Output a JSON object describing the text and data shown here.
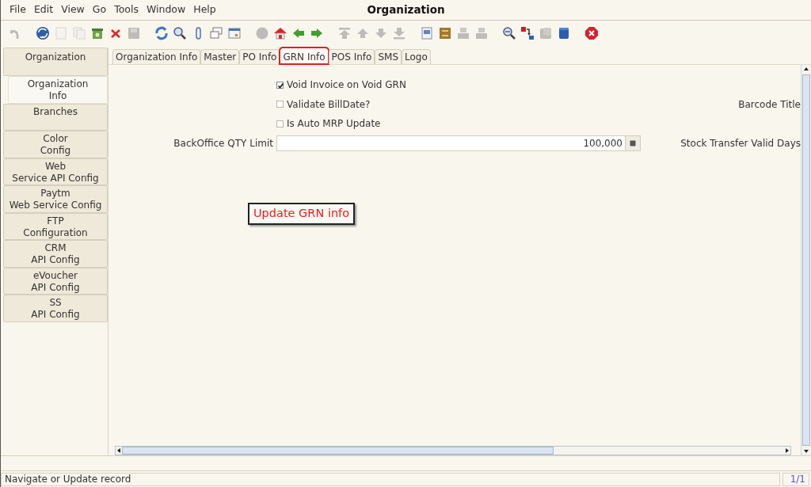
{
  "window": {
    "title": "Organization"
  },
  "menu": [
    "File",
    "Edit",
    "View",
    "Go",
    "Tools",
    "Window",
    "Help"
  ],
  "toolbar": [
    [
      {
        "kind": "undo",
        "disabled": true
      }
    ],
    [
      {
        "kind": "help",
        "disabled": false
      },
      {
        "kind": "new",
        "disabled": true
      },
      {
        "kind": "copy",
        "disabled": true
      },
      {
        "kind": "bin",
        "disabled": false
      },
      {
        "kind": "delete",
        "disabled": false
      },
      {
        "kind": "save",
        "disabled": true
      }
    ],
    [
      {
        "kind": "refresh",
        "disabled": false
      },
      {
        "kind": "find",
        "disabled": false
      },
      {
        "kind": "attach",
        "disabled": false
      },
      {
        "kind": "chat",
        "disabled": false
      },
      {
        "kind": "calendar",
        "disabled": false
      }
    ],
    [
      {
        "kind": "archive",
        "disabled": true
      },
      {
        "kind": "home",
        "disabled": false
      },
      {
        "kind": "back",
        "disabled": false
      },
      {
        "kind": "forward",
        "disabled": false
      }
    ],
    [
      {
        "kind": "first",
        "disabled": true
      },
      {
        "kind": "previous",
        "disabled": true
      },
      {
        "kind": "next",
        "disabled": true
      },
      {
        "kind": "last",
        "disabled": true
      }
    ],
    [
      {
        "kind": "report",
        "disabled": false
      },
      {
        "kind": "drawer",
        "disabled": false
      },
      {
        "kind": "print",
        "disabled": true
      },
      {
        "kind": "print",
        "disabled": true
      }
    ],
    [
      {
        "kind": "zoom",
        "disabled": false
      },
      {
        "kind": "workflow",
        "disabled": false
      },
      {
        "kind": "product",
        "disabled": true
      },
      {
        "kind": "cube",
        "disabled": false
      }
    ],
    [
      {
        "kind": "exit",
        "disabled": false
      }
    ]
  ],
  "sidebar": {
    "items": [
      {
        "label": "Organization",
        "selected": false
      },
      {
        "label": "Organization\nInfo",
        "selected": true
      },
      {
        "label": "Branches",
        "selected": false
      },
      {
        "label": "Color\nConfig",
        "selected": false
      },
      {
        "label": "Web\nService API Config",
        "selected": false
      },
      {
        "label": "Paytm\nWeb Service Config",
        "selected": false
      },
      {
        "label": "FTP\nConfiguration",
        "selected": false
      },
      {
        "label": "CRM\nAPI Config",
        "selected": false
      },
      {
        "label": "eVoucher\nAPI Config",
        "selected": false
      },
      {
        "label": "SS\nAPI Config",
        "selected": false
      }
    ]
  },
  "tabs": [
    {
      "label": "Organization Info",
      "selected": false,
      "highlighted": false
    },
    {
      "label": "Master",
      "selected": false,
      "highlighted": false
    },
    {
      "label": "PO Info",
      "selected": false,
      "highlighted": false
    },
    {
      "label": "GRN Info",
      "selected": true,
      "highlighted": true
    },
    {
      "label": "POS Info",
      "selected": false,
      "highlighted": false
    },
    {
      "label": "SMS",
      "selected": false,
      "highlighted": false
    },
    {
      "label": "Logo",
      "selected": false,
      "highlighted": false
    }
  ],
  "form": {
    "rows": [
      {
        "kind": "checkbox",
        "label": "Void Invoice on Void GRN",
        "checked": true
      },
      {
        "kind": "checkbox",
        "label": "Validate BillDate?",
        "checked": false,
        "side_label": "Barcode Title"
      },
      {
        "kind": "checkbox",
        "label": "Is Auto MRP Update",
        "checked": false
      },
      {
        "kind": "number",
        "label": "BackOffice QTY Limit",
        "value": "100,000",
        "side_label": "Stock Transfer Valid Days"
      }
    ]
  },
  "annotation": {
    "text": "Update GRN info"
  },
  "status_bar": {
    "message": "Navigate or Update record",
    "record": "1/1"
  }
}
